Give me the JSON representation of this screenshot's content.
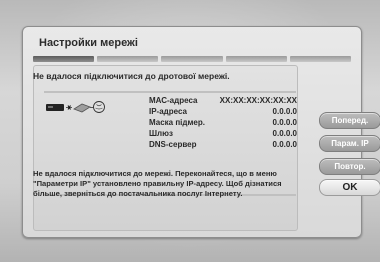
{
  "dialog": {
    "title": "Настройки мережі",
    "error_header": "Не вдалося підключитися до дротової мережі.",
    "message": "Не вдалося підключитися до мережі. Переконайтеся, що в меню \"Параметри IP\" установлено правильну IP-адресу. Щоб дізнатися більше, зверніться до постачальника послуг Інтернету."
  },
  "network": {
    "rows": [
      {
        "label": "МАС-адреса",
        "value": "XX:XX:XX:XX:XX:XX"
      },
      {
        "label": "IP-адреса",
        "value": "0.0.0.0"
      },
      {
        "label": "Маска підмер.",
        "value": "0.0.0.0"
      },
      {
        "label": "Шлюз",
        "value": "0.0.0.0"
      },
      {
        "label": "DNS-сервер",
        "value": "0.0.0.0"
      }
    ]
  },
  "buttons": {
    "previous": "Поперед.",
    "ip_settings": "Парам. IP",
    "retry": "Повтор.",
    "ok": "OK"
  },
  "icons": {
    "device": "tv-device-icon",
    "router": "router-icon",
    "internet": "globe-icon"
  }
}
